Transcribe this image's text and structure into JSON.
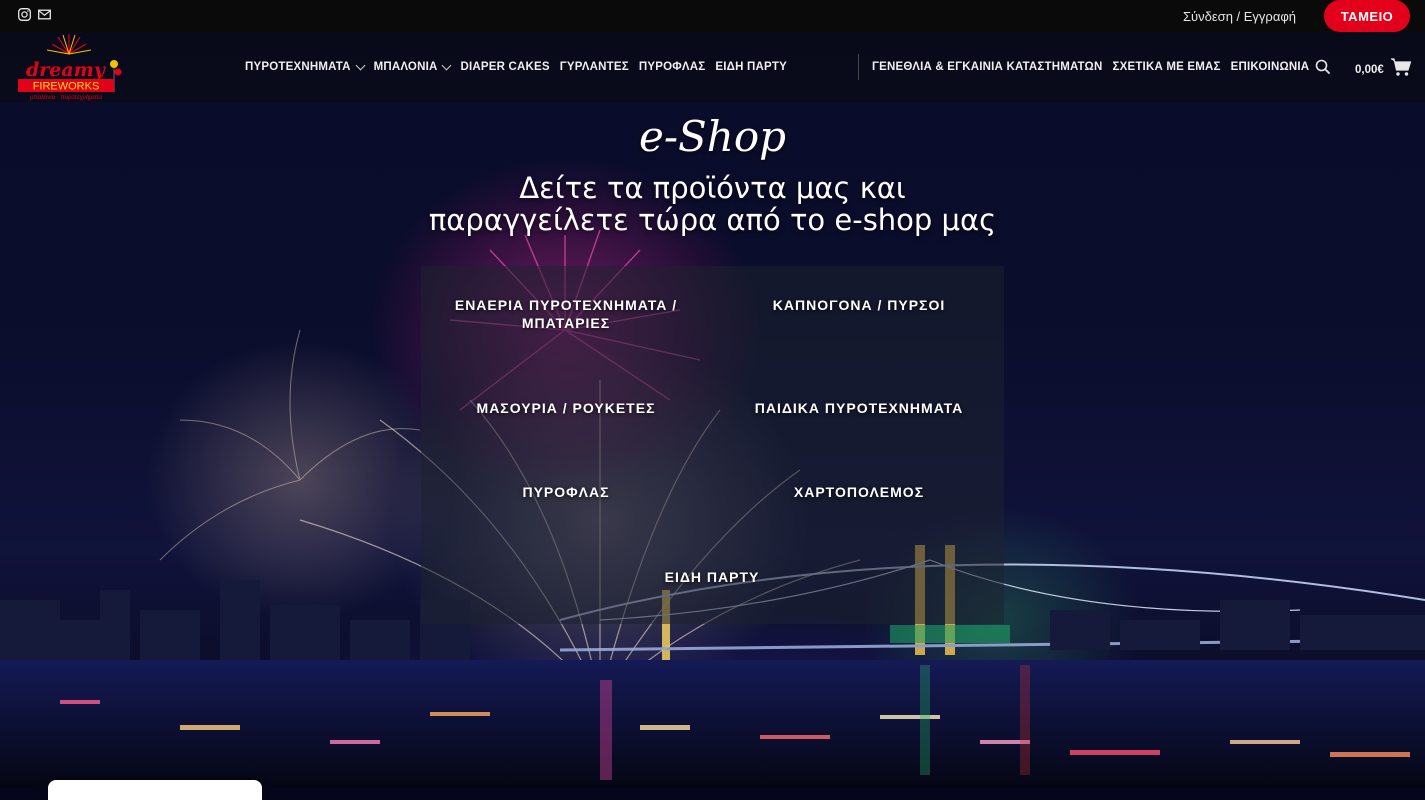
{
  "topbar": {
    "social": [
      {
        "icon": "instagram-icon"
      },
      {
        "icon": "mail-icon"
      }
    ],
    "login_link": "Σύνδεση / Εγγραφή",
    "checkout_button": "ΤΑΜΕΙΟ",
    "checkout_color": "#e3001b"
  },
  "header": {
    "logo": {
      "line1": "dreamy",
      "line2": "FIREWORKS",
      "line3": "μπαλόνια · πυροτεχνήματα"
    },
    "nav_left": [
      {
        "label": "ΠΥΡΟΤΕΧΝΗΜΑΤΑ",
        "dropdown": true
      },
      {
        "label": "ΜΠΑΛΟΝΙΑ",
        "dropdown": true
      },
      {
        "label": "DIAPER CAKES",
        "dropdown": false
      },
      {
        "label": "ΓΥΡΛΑΝΤΕΣ",
        "dropdown": false
      },
      {
        "label": "ΠΥΡΟΦΛΑΣ",
        "dropdown": false
      },
      {
        "label": "ΕΙΔΗ ΠΑΡΤΥ",
        "dropdown": false
      }
    ],
    "nav_right": [
      {
        "label": "ΓΕΝΕΘΛΙΑ & ΕΓΚΑΙΝΙΑ ΚΑΤΑΣΤΗΜΑΤΩΝ"
      },
      {
        "label": "ΣΧΕΤΙΚΑ ΜΕ ΕΜΑΣ"
      },
      {
        "label": "ΕΠΙΚΟΙΝΩΝΙΑ"
      }
    ],
    "search_icon": "search-icon",
    "cart_amount": "0,00€",
    "cart_icon": "cart-icon"
  },
  "hero": {
    "eshop_title": "e-Shop",
    "headline_line1": "Δείτε τα προϊόντα μας και",
    "headline_line2": "παραγγείλετε τώρα από το e-shop μας"
  },
  "categories": [
    {
      "label": "ΕΝΑΕΡΙΑ ΠΥΡΟΤΕΧΝΗΜΑΤΑ / ΜΠΑΤΑΡΙΕΣ"
    },
    {
      "label": "ΚΑΠΝΟΓΟΝΑ / ΠΥΡΣΟΙ"
    },
    {
      "label": "ΜΑΣΟΥΡΙΑ / ΡΟΥΚΕΤΕΣ"
    },
    {
      "label": "ΠΑΙΔΙΚΑ ΠΥΡΟΤΕΧΝΗΜΑΤΑ"
    },
    {
      "label": "ΠΥΡΟΦΛΑΣ"
    },
    {
      "label": "ΧΑΡΤΟΠΟΛΕΜΟΣ"
    },
    {
      "label": "ΕΙΔΗ ΠΑΡΤΥ"
    }
  ]
}
